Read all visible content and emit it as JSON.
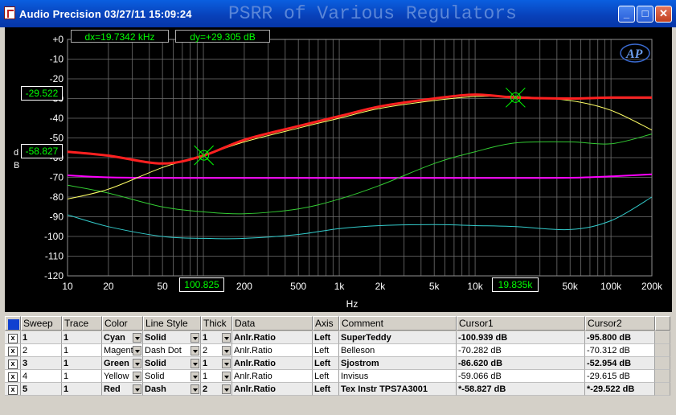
{
  "window": {
    "title": "Audio Precision  03/27/11 15:09:24",
    "chart_title": "PSRR of Various Regulators"
  },
  "readouts": {
    "dx": "dx=19.7342 kHz",
    "dy": "dy=+29.305  dB",
    "cursor1_y": "-58.827",
    "cursor2_y": "-29.522",
    "cursor1_x": "100.825",
    "cursor2_x": "19.835k"
  },
  "logo_text": "AP",
  "chart_data": {
    "type": "line",
    "title": "PSRR of Various Regulators",
    "xlabel": "Hz",
    "ylabel": "dB",
    "x_scale": "log",
    "xlim": [
      10,
      200000
    ],
    "ylim": [
      -120,
      0
    ],
    "grid": true,
    "y_ticks": [
      0,
      -10,
      -20,
      -30,
      -40,
      -50,
      -60,
      -70,
      -80,
      -90,
      -100,
      -110,
      -120
    ],
    "y_tick_labels": [
      "+0",
      "-10",
      "-20",
      "-30",
      "-40",
      "-50",
      "-60",
      "-70",
      "-80",
      "-90",
      "-100",
      "-110",
      "-120"
    ],
    "x_ticks": [
      10,
      20,
      50,
      200,
      500,
      1000,
      2000,
      5000,
      10000,
      50000,
      100000,
      200000
    ],
    "x_tick_labels": [
      "10",
      "20",
      "50",
      "200",
      "500",
      "1k",
      "2k",
      "5k",
      "10k",
      "50k",
      "100k",
      "200k"
    ],
    "cursors": [
      {
        "x": 100.825,
        "y": -58.827
      },
      {
        "x": 19835,
        "y": -29.522
      }
    ],
    "series": [
      {
        "name": "SuperTeddy",
        "color": "#33cccc",
        "width": 1,
        "x": [
          10,
          20,
          50,
          100,
          200,
          500,
          1000,
          2000,
          5000,
          10000,
          20000,
          50000,
          100000,
          200000
        ],
        "y": [
          -89,
          -95,
          -100,
          -101,
          -101,
          -99,
          -96,
          -94.5,
          -94,
          -94.5,
          -95,
          -96.5,
          -92,
          -80
        ]
      },
      {
        "name": "Belleson",
        "color": "#ff00ff",
        "width": 2,
        "x": [
          10,
          20,
          50,
          100,
          200,
          500,
          1000,
          2000,
          5000,
          10000,
          20000,
          50000,
          100000,
          200000
        ],
        "y": [
          -69,
          -70,
          -70.3,
          -70.3,
          -70.3,
          -70.3,
          -70.3,
          -70.3,
          -70.3,
          -70.3,
          -70.3,
          -70.2,
          -69.5,
          -68.5
        ]
      },
      {
        "name": "Sjostrom",
        "color": "#33cc33",
        "width": 1,
        "x": [
          10,
          20,
          50,
          100,
          200,
          500,
          1000,
          2000,
          5000,
          10000,
          20000,
          50000,
          100000,
          200000
        ],
        "y": [
          -74,
          -78,
          -85,
          -87.5,
          -88.5,
          -86,
          -81,
          -74,
          -63,
          -57,
          -52.5,
          -52,
          -53,
          -48
        ]
      },
      {
        "name": "Invisus",
        "color": "#ffff66",
        "width": 1,
        "x": [
          10,
          20,
          50,
          100,
          200,
          500,
          1000,
          2000,
          5000,
          10000,
          20000,
          50000,
          100000,
          200000
        ],
        "y": [
          -81,
          -76,
          -65,
          -59,
          -52,
          -45,
          -40,
          -35,
          -31,
          -29,
          -29,
          -31,
          -36,
          -46
        ]
      },
      {
        "name": "Tex Instr TPS7A3001",
        "color": "#ff2020",
        "width": 3,
        "x": [
          10,
          20,
          50,
          100,
          200,
          500,
          1000,
          2000,
          5000,
          10000,
          20000,
          50000,
          100000,
          200000
        ],
        "y": [
          -57,
          -59,
          -63,
          -59,
          -51,
          -44,
          -39,
          -34,
          -30,
          -28,
          -29.5,
          -30,
          -29.5,
          -29.5
        ]
      }
    ]
  },
  "table": {
    "headers": [
      "Sweep",
      "Trace",
      "Color",
      "Line Style",
      "Thick",
      "Data",
      "Axis",
      "Comment",
      "Cursor1",
      "Cursor2"
    ],
    "rows": [
      {
        "sweep": "1",
        "trace": "1",
        "color": "Cyan",
        "style": "Solid",
        "thick": "1",
        "data": "Anlr.Ratio",
        "axis": "Left",
        "comment": "SuperTeddy",
        "c1": "-100.939  dB",
        "c2": "-95.800  dB",
        "bold": true
      },
      {
        "sweep": "2",
        "trace": "1",
        "color": "Magenta",
        "style": "Dash Dot",
        "thick": "2",
        "data": "Anlr.Ratio",
        "axis": "Left",
        "comment": "Belleson",
        "c1": "-70.282  dB",
        "c2": "-70.312  dB",
        "bold": false
      },
      {
        "sweep": "3",
        "trace": "1",
        "color": "Green",
        "style": "Solid",
        "thick": "1",
        "data": "Anlr.Ratio",
        "axis": "Left",
        "comment": "Sjostrom",
        "c1": "-86.620  dB",
        "c2": "-52.954  dB",
        "bold": true
      },
      {
        "sweep": "4",
        "trace": "1",
        "color": "Yellow",
        "style": "Solid",
        "thick": "1",
        "data": "Anlr.Ratio",
        "axis": "Left",
        "comment": "Invisus",
        "c1": "-59.066  dB",
        "c2": "-29.615  dB",
        "bold": false
      },
      {
        "sweep": "5",
        "trace": "1",
        "color": "Red",
        "style": "Dash",
        "thick": "2",
        "data": "Anlr.Ratio",
        "axis": "Left",
        "comment": "Tex Instr TPS7A3001",
        "c1": "*-58.827  dB",
        "c2": "*-29.522  dB",
        "bold": true
      }
    ],
    "row_mark": "x"
  }
}
